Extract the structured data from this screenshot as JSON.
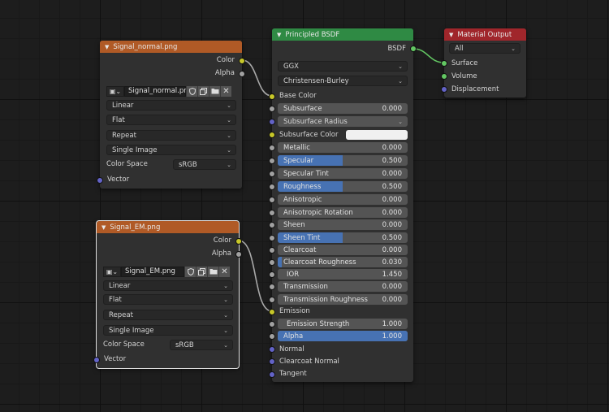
{
  "colors": {
    "yellow_socket": "#c7c729",
    "gray_socket": "#a1a1a1",
    "blue_socket": "#6363c7",
    "green_socket": "#63c763",
    "slider_fill": "#4772b3",
    "header_texture": "#b05a26",
    "header_shader": "#2f8a44",
    "header_output": "#a0262b"
  },
  "node_normal": {
    "title": "Signal_normal.png",
    "outputs": [
      "Color",
      "Alpha"
    ],
    "image_name": "Signal_normal.png",
    "interpolation": "Linear",
    "projection": "Flat",
    "extension": "Repeat",
    "source": "Single Image",
    "color_space_label": "Color Space",
    "color_space": "sRGB",
    "vector_label": "Vector"
  },
  "node_em": {
    "title": "Signal_EM.png",
    "outputs": [
      "Color",
      "Alpha"
    ],
    "image_name": "Signal_EM.png",
    "interpolation": "Linear",
    "projection": "Flat",
    "extension": "Repeat",
    "source": "Single Image",
    "color_space_label": "Color Space",
    "color_space": "sRGB",
    "vector_label": "Vector"
  },
  "bsdf": {
    "title": "Principled BSDF",
    "output": "BSDF",
    "distribution": "GGX",
    "subsurface_method": "Christensen-Burley",
    "base_color_label": "Base Color",
    "subsurface_radius": "Subsurface Radius",
    "subsurface_color_label": "Subsurface Color",
    "emission_label": "Emission",
    "normal_label": "Normal",
    "clearcoat_normal_label": "Clearcoat Normal",
    "tangent_label": "Tangent",
    "fields": [
      {
        "label": "Subsurface",
        "value": "0.000",
        "fill": 0
      },
      {
        "label": "Metallic",
        "value": "0.000",
        "fill": 0
      },
      {
        "label": "Specular",
        "value": "0.500",
        "fill": 0.5
      },
      {
        "label": "Specular Tint",
        "value": "0.000",
        "fill": 0
      },
      {
        "label": "Roughness",
        "value": "0.500",
        "fill": 0.5
      },
      {
        "label": "Anisotropic",
        "value": "0.000",
        "fill": 0
      },
      {
        "label": "Anisotropic Rotation",
        "value": "0.000",
        "fill": 0
      },
      {
        "label": "Sheen",
        "value": "0.000",
        "fill": 0
      },
      {
        "label": "Sheen Tint",
        "value": "0.500",
        "fill": 0.5
      },
      {
        "label": "Clearcoat",
        "value": "0.000",
        "fill": 0
      },
      {
        "label": "Clearcoat Roughness",
        "value": "0.030",
        "fill": 0.03
      },
      {
        "label": "IOR",
        "value": "1.450",
        "fill": 0
      },
      {
        "label": "Transmission",
        "value": "0.000",
        "fill": 0
      },
      {
        "label": "Transmission Roughness",
        "value": "0.000",
        "fill": 0
      },
      {
        "label": "Emission Strength",
        "value": "1.000",
        "fill": 0
      },
      {
        "label": "Alpha",
        "value": "1.000",
        "fill": 1
      }
    ]
  },
  "output_node": {
    "title": "Material Output",
    "target": "All",
    "inputs": [
      "Surface",
      "Volume",
      "Displacement"
    ]
  }
}
